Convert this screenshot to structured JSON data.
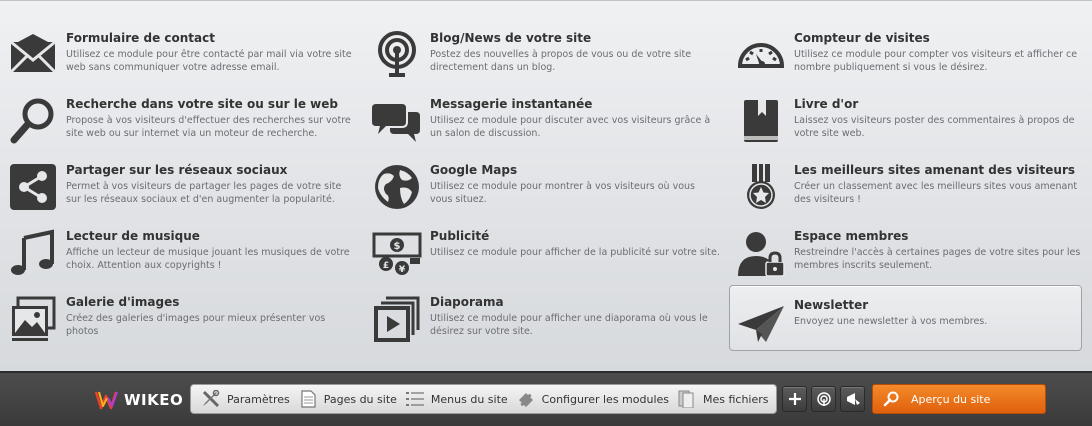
{
  "modules": [
    {
      "title": "Formulaire de contact",
      "desc": "Utilisez ce module pour être contacté par mail via votre site web sans communiquer votre adresse email.",
      "icon": "envelope-icon"
    },
    {
      "title": "Blog/News de votre site",
      "desc": "Postez des nouvelles à propos de vous ou de votre site directement dans un blog.",
      "icon": "broadcast-icon"
    },
    {
      "title": "Compteur de visites",
      "desc": "Utilisez ce module pour compter vos visiteurs et afficher ce nombre publiquement si vous le désirez.",
      "icon": "gauge-icon"
    },
    {
      "title": "Recherche dans votre site ou sur le web",
      "desc": "Propose à vos visiteurs d'effectuer des recherches sur votre site web ou sur internet via un moteur de recherche.",
      "icon": "magnifier-icon"
    },
    {
      "title": "Messagerie instantanée",
      "desc": "Utilisez ce module pour discuter avec vos visiteurs grâce à un salon de discussion.",
      "icon": "chat-bubbles-icon"
    },
    {
      "title": "Livre d'or",
      "desc": "Laissez vos visiteurs poster des commentaires à propos de votre site web.",
      "icon": "book-icon"
    },
    {
      "title": "Partager sur les réseaux sociaux",
      "desc": "Permet à vos visiteurs de partager les pages de votre site sur les réseaux sociaux et d'en augmenter la popularité.",
      "icon": "share-icon"
    },
    {
      "title": "Google Maps",
      "desc": "Utilisez ce module pour montrer à vos visiteurs où vous vous situez.",
      "icon": "globe-icon"
    },
    {
      "title": "Les meilleurs sites amenant des visiteurs",
      "desc": "Créer un classement avec les meilleurs sites vous amenant des visiteurs !",
      "icon": "medal-icon"
    },
    {
      "title": "Lecteur de musique",
      "desc": "Affiche un lecteur de musique jouant les musiques de votre choix. Attention aux copyrights !",
      "icon": "music-note-icon"
    },
    {
      "title": "Publicité",
      "desc": "Utilisez ce module pour afficher de la publicité sur votre site.",
      "icon": "currency-icon"
    },
    {
      "title": "Espace membres",
      "desc": "Restreindre l'accès à certaines pages de votre sites pour les membres inscrits seulement.",
      "icon": "member-lock-icon"
    },
    {
      "title": "Galerie d'images",
      "desc": "Créez des galeries d'images pour mieux présenter vos photos",
      "icon": "image-gallery-icon"
    },
    {
      "title": "Diaporama",
      "desc": "Utilisez ce module pour afficher une diaporama où vous le désirez sur votre site.",
      "icon": "slideshow-icon"
    },
    {
      "title": "Newsletter",
      "desc": "Envoyez une newsletter à vos membres.",
      "icon": "paper-plane-icon"
    }
  ],
  "toolbar": {
    "logo_text": "WIKEO",
    "nav": [
      {
        "label": "Paramètres",
        "icon": "tools-icon"
      },
      {
        "label": "Pages du site",
        "icon": "page-icon"
      },
      {
        "label": "Menus du site",
        "icon": "list-icon"
      },
      {
        "label": "Configurer les modules",
        "icon": "puzzle-icon"
      },
      {
        "label": "Mes fichiers",
        "icon": "files-icon"
      }
    ],
    "preview_label": "Aperçu du site",
    "accent": "#ee7518"
  }
}
